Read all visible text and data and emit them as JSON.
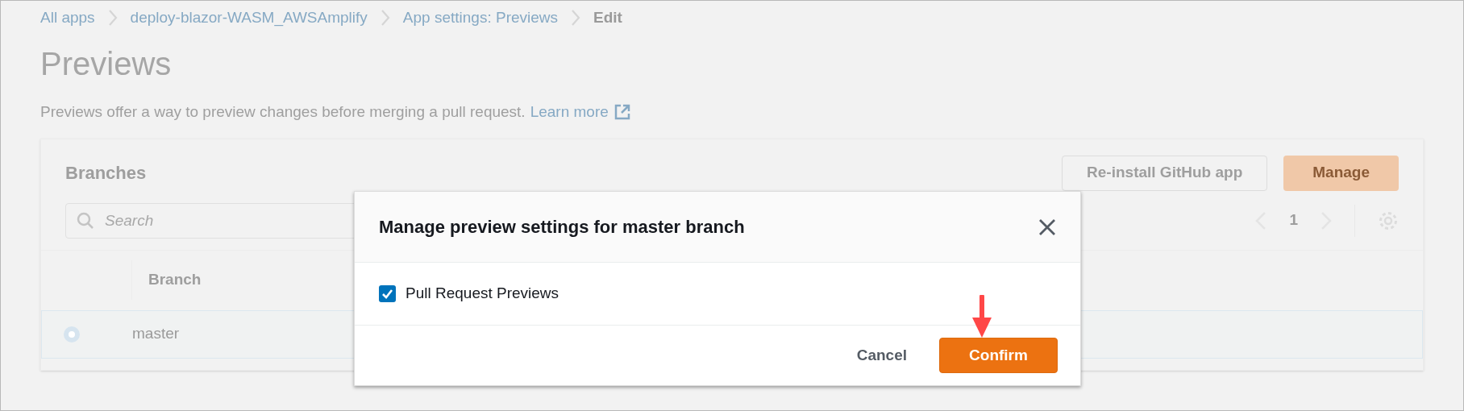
{
  "breadcrumbs": [
    {
      "label": "All apps",
      "current": false
    },
    {
      "label": "deploy-blazor-WASM_AWSAmplify",
      "current": false
    },
    {
      "label": "App settings: Previews",
      "current": false
    },
    {
      "label": "Edit",
      "current": true
    }
  ],
  "page": {
    "title": "Previews",
    "description": "Previews offer a way to preview changes before merging a pull request.",
    "learn_more": "Learn more"
  },
  "branches_panel": {
    "title": "Branches",
    "buttons": [
      {
        "label": "Re-install GitHub app",
        "kind": "secondary"
      },
      {
        "label": "Manage",
        "kind": "primary"
      }
    ],
    "search": {
      "placeholder": "Search"
    },
    "pagination": {
      "page": "1"
    },
    "table": {
      "columns": [
        "Branch"
      ],
      "rows": [
        {
          "branch": "master",
          "selected": true
        }
      ]
    }
  },
  "dialog": {
    "title": "Manage preview settings for master branch",
    "checkbox": {
      "label": "Pull Request Previews",
      "checked": true
    },
    "buttons": [
      {
        "label": "Cancel",
        "kind": "link"
      },
      {
        "label": "Confirm",
        "kind": "primary"
      }
    ]
  }
}
